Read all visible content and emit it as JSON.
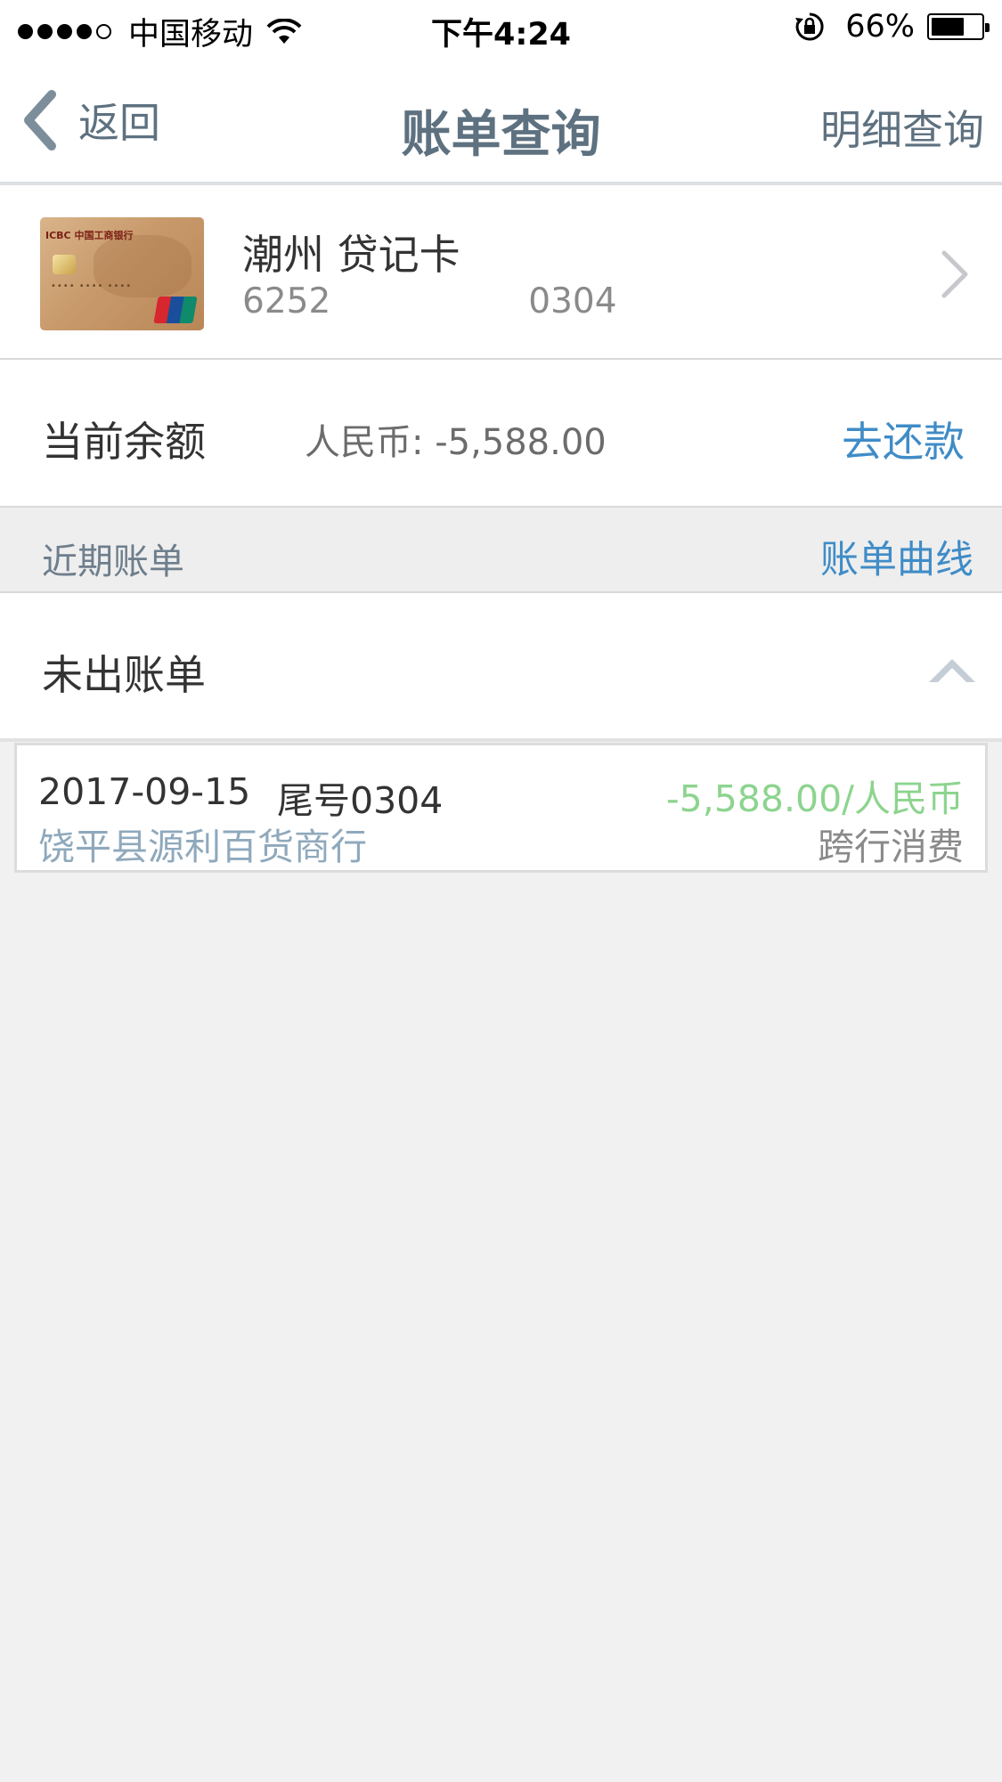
{
  "status_bar": {
    "carrier": "中国移动",
    "time": "下午4:24",
    "battery": "66%"
  },
  "nav": {
    "back_label": "返回",
    "title": "账单查询",
    "detail_label": "明细查询"
  },
  "card": {
    "name": "潮州 贷记卡",
    "number_prefix": "6252",
    "number_suffix": "0304",
    "image": {
      "bank_text": "ICBC 中国工商银行",
      "logo_text": "UnionPay 银联"
    }
  },
  "balance": {
    "label": "当前余额",
    "value": "人民币: -5,588.00",
    "action_label": "去还款"
  },
  "recent": {
    "title": "近期账单",
    "curve_label": "账单曲线"
  },
  "unbilled": {
    "label": "未出账单"
  },
  "transactions": [
    {
      "date": "2017-09-15",
      "tail": "尾号0304",
      "amount": "-5,588.00/人民币",
      "merchant": "饶平县源利百货商行",
      "type": "跨行消费"
    }
  ],
  "colors": {
    "nav_text": "#5e7180",
    "link_blue": "#3f8cc7",
    "amount_green": "#8dd48f",
    "merchant_blue": "#8fa9bc",
    "background": "#f1f1f1"
  }
}
